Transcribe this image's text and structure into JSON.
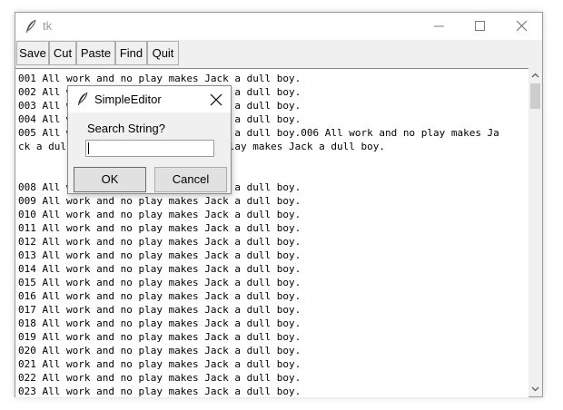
{
  "window": {
    "title": "tk",
    "toolbar": [
      {
        "label": "Save"
      },
      {
        "label": "Cut"
      },
      {
        "label": "Paste"
      },
      {
        "label": "Find"
      },
      {
        "label": "Quit"
      }
    ]
  },
  "editor": {
    "lines": [
      "001 All work and no play makes Jack a dull boy.",
      "002 All work and no play makes Jack a dull boy.",
      "003 All work and no play makes Jack a dull boy.",
      "004 All work and no play makes Jack a dull boy.",
      "005 All work and no play makes Jack a dull boy.006 All work and no play makes Ja",
      "ck a dull boy.007 All work and no play makes Jack a dull boy.",
      "",
      "",
      "008 All work and no play makes Jack a dull boy.",
      "009 All work and no play makes Jack a dull boy.",
      "010 All work and no play makes Jack a dull boy.",
      "011 All work and no play makes Jack a dull boy.",
      "012 All work and no play makes Jack a dull boy.",
      "013 All work and no play makes Jack a dull boy.",
      "014 All work and no play makes Jack a dull boy.",
      "015 All work and no play makes Jack a dull boy.",
      "016 All work and no play makes Jack a dull boy.",
      "017 All work and no play makes Jack a dull boy.",
      "018 All work and no play makes Jack a dull boy.",
      "019 All work and no play makes Jack a dull boy.",
      "020 All work and no play makes Jack a dull boy.",
      "021 All work and no play makes Jack a dull boy.",
      "022 All work and no play makes Jack a dull boy.",
      "023 All work and no play makes Jack a dull boy."
    ]
  },
  "dialog": {
    "title": "SimpleEditor",
    "prompt": "Search String?",
    "input_value": "",
    "ok_label": "OK",
    "cancel_label": "Cancel"
  },
  "icons": {
    "app": "feather-icon",
    "minimize": "minimize-icon",
    "maximize": "maximize-icon",
    "close": "close-icon",
    "scroll_up": "chevron-up-icon",
    "scroll_down": "chevron-down-icon"
  }
}
